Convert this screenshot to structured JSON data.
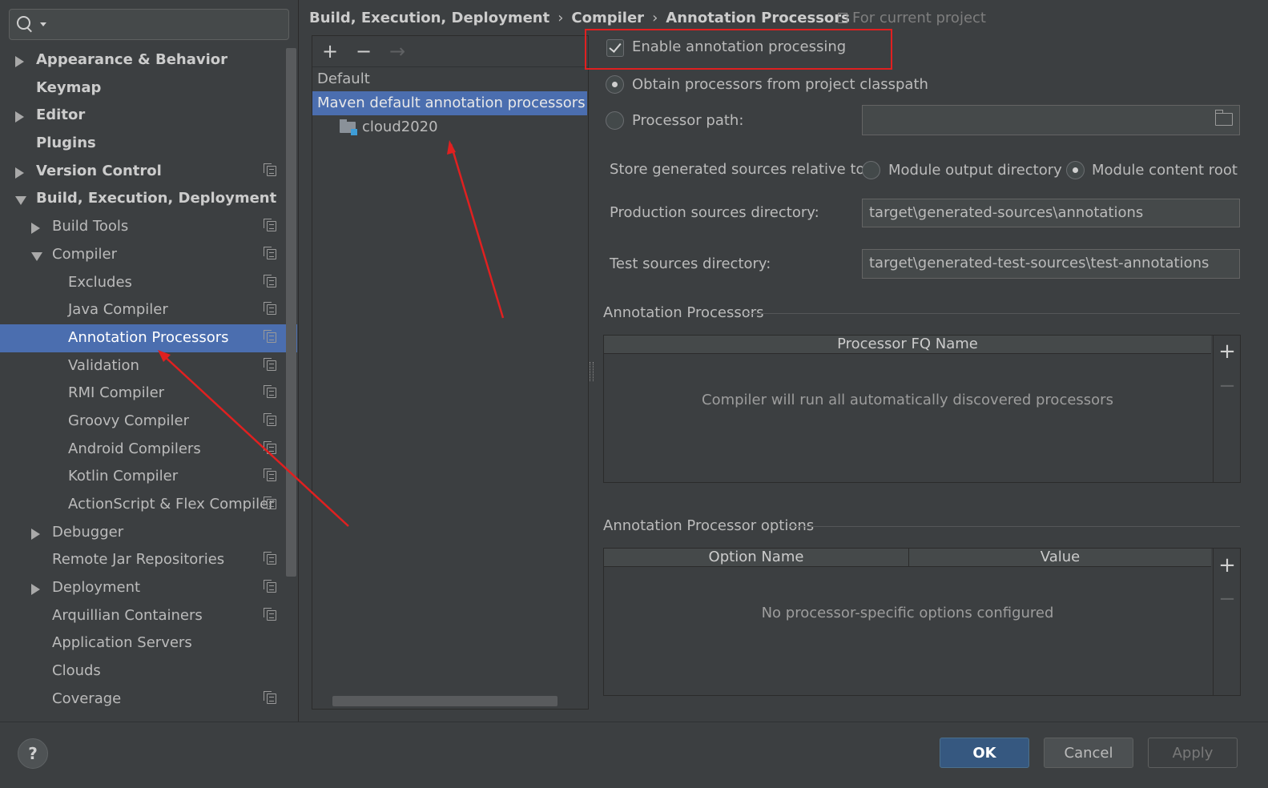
{
  "search": {
    "placeholder": "",
    "value": ""
  },
  "sidebar": {
    "items": [
      {
        "label": "Appearance & Behavior",
        "arrow": "right",
        "bold": true,
        "project": false
      },
      {
        "label": "Keymap",
        "arrow": "none",
        "bold": true,
        "project": false
      },
      {
        "label": "Editor",
        "arrow": "right",
        "bold": true,
        "project": false
      },
      {
        "label": "Plugins",
        "arrow": "none",
        "bold": true,
        "project": false
      },
      {
        "label": "Version Control",
        "arrow": "right",
        "bold": true,
        "project": true
      },
      {
        "label": "Build, Execution, Deployment",
        "arrow": "down",
        "bold": true,
        "project": false
      },
      {
        "label": "Build Tools",
        "arrow": "right",
        "bold": false,
        "project": true
      },
      {
        "label": "Compiler",
        "arrow": "down",
        "bold": false,
        "project": true
      },
      {
        "label": "Excludes",
        "arrow": "none",
        "bold": false,
        "project": true
      },
      {
        "label": "Java Compiler",
        "arrow": "none",
        "bold": false,
        "project": true
      },
      {
        "label": "Annotation Processors",
        "arrow": "none",
        "bold": false,
        "project": true,
        "selected": true
      },
      {
        "label": "Validation",
        "arrow": "none",
        "bold": false,
        "project": true
      },
      {
        "label": "RMI Compiler",
        "arrow": "none",
        "bold": false,
        "project": true
      },
      {
        "label": "Groovy Compiler",
        "arrow": "none",
        "bold": false,
        "project": true
      },
      {
        "label": "Android Compilers",
        "arrow": "none",
        "bold": false,
        "project": true
      },
      {
        "label": "Kotlin Compiler",
        "arrow": "none",
        "bold": false,
        "project": true
      },
      {
        "label": "ActionScript & Flex Compiler",
        "arrow": "none",
        "bold": false,
        "project": true
      },
      {
        "label": "Debugger",
        "arrow": "right",
        "bold": false,
        "project": false
      },
      {
        "label": "Remote Jar Repositories",
        "arrow": "none",
        "bold": false,
        "project": true
      },
      {
        "label": "Deployment",
        "arrow": "right",
        "bold": false,
        "project": true
      },
      {
        "label": "Arquillian Containers",
        "arrow": "none",
        "bold": false,
        "project": true
      },
      {
        "label": "Application Servers",
        "arrow": "none",
        "bold": false,
        "project": false
      },
      {
        "label": "Clouds",
        "arrow": "none",
        "bold": false,
        "project": false
      },
      {
        "label": "Coverage",
        "arrow": "none",
        "bold": false,
        "project": true
      }
    ]
  },
  "header": {
    "breadcrumb": [
      "Build, Execution, Deployment",
      "Compiler",
      "Annotation Processors"
    ],
    "separator": "›",
    "scope": "For current project"
  },
  "profiles": {
    "toolbar": {
      "add": "+",
      "remove": "−",
      "move": "→"
    },
    "default_label": "Default",
    "selected_profile": "Maven default annotation processors profile",
    "module": "cloud2020"
  },
  "settings": {
    "enable_label": "Enable annotation processing",
    "enable_checked": true,
    "obtain_label": "Obtain processors from project classpath",
    "processor_path_label": "Processor path:",
    "processor_path_value": "",
    "store_label": "Store generated sources relative to:",
    "module_output_label": "Module output directory",
    "module_content_label": "Module content root",
    "production_label": "Production sources directory:",
    "production_value": "target\\generated-sources\\annotations",
    "test_label": "Test sources directory:",
    "test_value": "target\\generated-test-sources\\test-annotations"
  },
  "processors_section": {
    "title": "Annotation Processors",
    "column": "Processor FQ Name",
    "empty_text": "Compiler will run all automatically discovered processors",
    "add": "+",
    "remove": "−"
  },
  "options_section": {
    "title": "Annotation Processor options",
    "columns": [
      "Option Name",
      "Value"
    ],
    "empty_text": "No processor-specific options configured",
    "add": "+",
    "remove": "−"
  },
  "footer": {
    "help": "?",
    "ok": "OK",
    "cancel": "Cancel",
    "apply": "Apply"
  },
  "colors": {
    "selection": "#4b6eaf",
    "annotation": "#e02020",
    "background": "#3c3f41"
  }
}
